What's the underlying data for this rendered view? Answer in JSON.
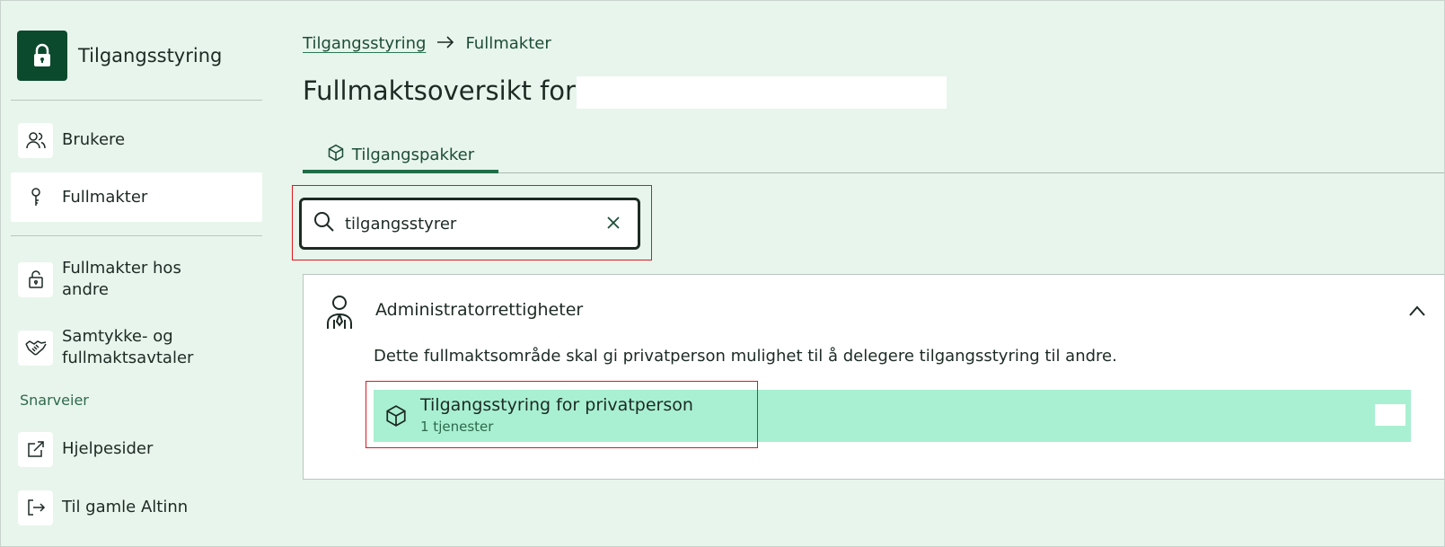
{
  "app": {
    "title": "Tilgangsstyring",
    "icon": "lock-icon"
  },
  "sidebar": {
    "items": [
      {
        "label": "Brukere",
        "icon": "users-icon"
      },
      {
        "label": "Fullmakter",
        "icon": "key-icon",
        "active": true
      },
      {
        "label": "Fullmakter hos\nandre",
        "icon": "lock-open-icon"
      },
      {
        "label": "Samtykke- og\nfullmaktsavtaler",
        "icon": "handshake-icon"
      }
    ],
    "shortcuts_heading": "Snarveier",
    "shortcuts": [
      {
        "label": "Hjelpesider",
        "icon": "external-link-icon"
      },
      {
        "label": "Til gamle Altinn",
        "icon": "logout-icon"
      }
    ]
  },
  "breadcrumb": {
    "link": "Tilgangsstyring",
    "current": "Fullmakter"
  },
  "page": {
    "title": "Fullmaktsoversikt for"
  },
  "tabs": [
    {
      "label": "Tilgangspakker",
      "icon": "package-icon",
      "active": true
    }
  ],
  "search": {
    "value": "tilgangsstyrer"
  },
  "area": {
    "title": "Administratorrettigheter",
    "description": "Dette fullmaktsområde skal gi privatperson mulighet til å delegere tilgangsstyring til andre.",
    "package": {
      "title": "Tilgangsstyring for privatperson",
      "subtitle": "1 tjenester"
    }
  },
  "colors": {
    "background": "#e8f5ec",
    "brand": "#0b4a2d",
    "package_highlight": "#a8f0d1",
    "annotation_red": "#e0151f"
  }
}
